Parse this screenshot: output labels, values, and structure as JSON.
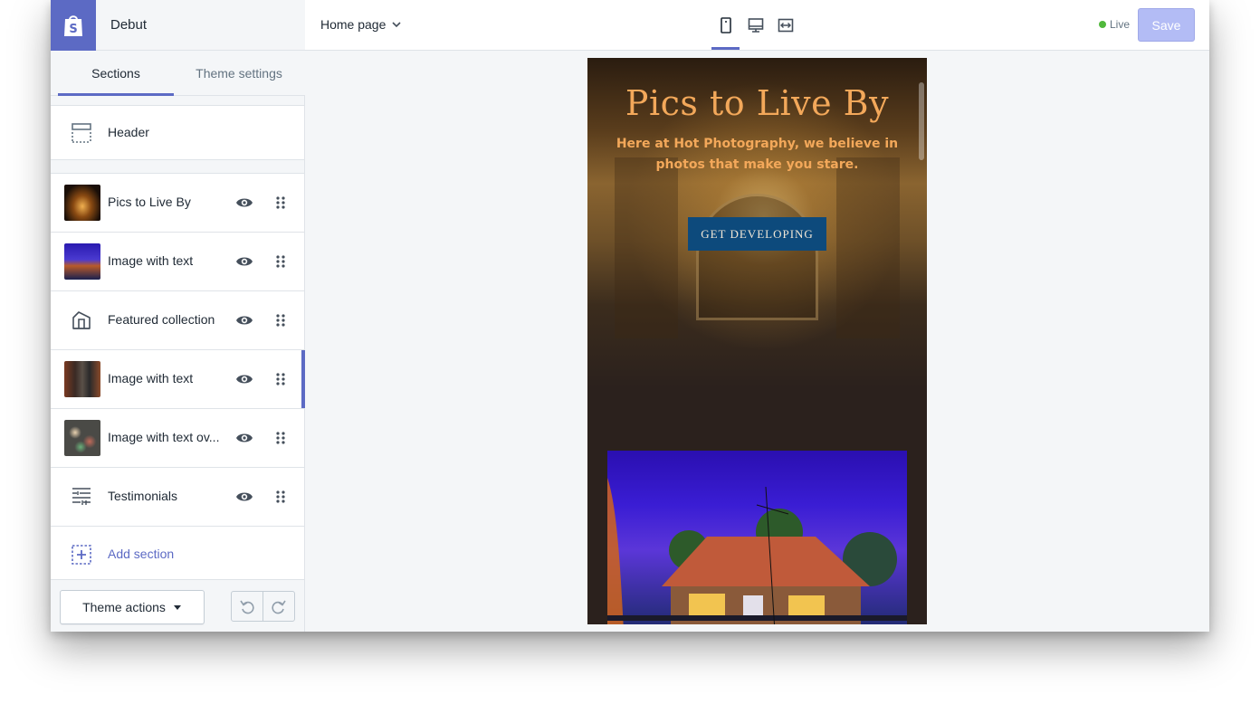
{
  "brand": {
    "theme_name": "Debut",
    "logo_icon": "shopify-bag-icon"
  },
  "tabs": [
    {
      "label": "Sections",
      "active": true
    },
    {
      "label": "Theme settings",
      "active": false
    }
  ],
  "header_section": {
    "label": "Header",
    "icon": "header-layout-icon"
  },
  "sections": [
    {
      "label": "Pics to Live By",
      "thumb": "cathedral-night-thumb",
      "visible": true,
      "selected": false
    },
    {
      "label": "Image with text",
      "thumb": "house-blue-thumb",
      "visible": true,
      "selected": false
    },
    {
      "label": "Featured collection",
      "icon": "collection-icon",
      "visible": true,
      "selected": false
    },
    {
      "label": "Image with text",
      "thumb": "alley-thumb",
      "visible": true,
      "selected": true
    },
    {
      "label": "Image with text ov...",
      "thumb": "bokeh-lights-thumb",
      "visible": true,
      "selected": false
    },
    {
      "label": "Testimonials",
      "icon": "text-lines-icon",
      "visible": true,
      "selected": false
    }
  ],
  "add_section": {
    "label": "Add section",
    "icon": "add-section-icon"
  },
  "footer": {
    "theme_actions_label": "Theme actions",
    "undo_icon": "undo-icon",
    "redo_icon": "redo-icon"
  },
  "topbar": {
    "page_label": "Home page",
    "devices": [
      {
        "name": "mobile",
        "active": true
      },
      {
        "name": "desktop",
        "active": false
      },
      {
        "name": "fullscreen",
        "active": false
      }
    ],
    "live_label": "Live",
    "save_label": "Save"
  },
  "preview": {
    "hero_title": "Pics to Live By",
    "hero_subtitle": "Here at Hot Photography, we believe in photos that make you stare.",
    "hero_button": "GET DEVELOPING"
  },
  "colors": {
    "accent": "#5c6ac4",
    "hero_text": "#f3a85a",
    "hero_button_bg": "#0d4a7c",
    "live_dot": "#50b83c",
    "save_disabled": "#b3bcf5"
  }
}
